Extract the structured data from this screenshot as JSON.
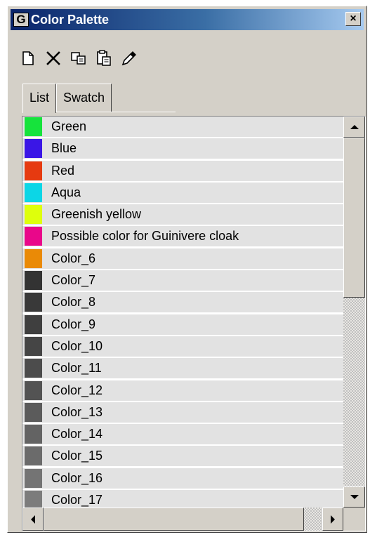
{
  "window": {
    "title": "Color Palette",
    "app_icon_glyph": "G",
    "close_glyph": "×"
  },
  "toolbar": {
    "buttons": [
      {
        "name": "new-color",
        "icon": "new-document-icon"
      },
      {
        "name": "delete-color",
        "icon": "x-delete-icon"
      },
      {
        "name": "copy-color",
        "icon": "copy-icon"
      },
      {
        "name": "paste-color",
        "icon": "paste-icon"
      },
      {
        "name": "eyedropper",
        "icon": "eyedropper-icon"
      }
    ]
  },
  "tabs": [
    {
      "label": "List",
      "active": true
    },
    {
      "label": "Swatch",
      "active": false
    }
  ],
  "colors": [
    {
      "label": "Green",
      "swatch": "#16e33c"
    },
    {
      "label": "Blue",
      "swatch": "#3a16e6"
    },
    {
      "label": "Red",
      "swatch": "#e63a10"
    },
    {
      "label": "Aqua",
      "swatch": "#0cd6e6"
    },
    {
      "label": "Greenish yellow",
      "swatch": "#deff0c"
    },
    {
      "label": "Possible color for Guinivere cloak",
      "swatch": "#e9078a"
    },
    {
      "label": "Color_6",
      "swatch": "#ea8a06"
    },
    {
      "label": "Color_7",
      "swatch": "#333333"
    },
    {
      "label": "Color_8",
      "swatch": "#393939"
    },
    {
      "label": "Color_9",
      "swatch": "#3f3f3f"
    },
    {
      "label": "Color_10",
      "swatch": "#454545"
    },
    {
      "label": "Color_11",
      "swatch": "#4c4c4c"
    },
    {
      "label": "Color_12",
      "swatch": "#535353"
    },
    {
      "label": "Color_13",
      "swatch": "#5b5b5b"
    },
    {
      "label": "Color_14",
      "swatch": "#636363"
    },
    {
      "label": "Color_15",
      "swatch": "#6b6b6b"
    },
    {
      "label": "Color_16",
      "swatch": "#747474"
    },
    {
      "label": "Color_17",
      "swatch": "#7c7c7c"
    }
  ]
}
